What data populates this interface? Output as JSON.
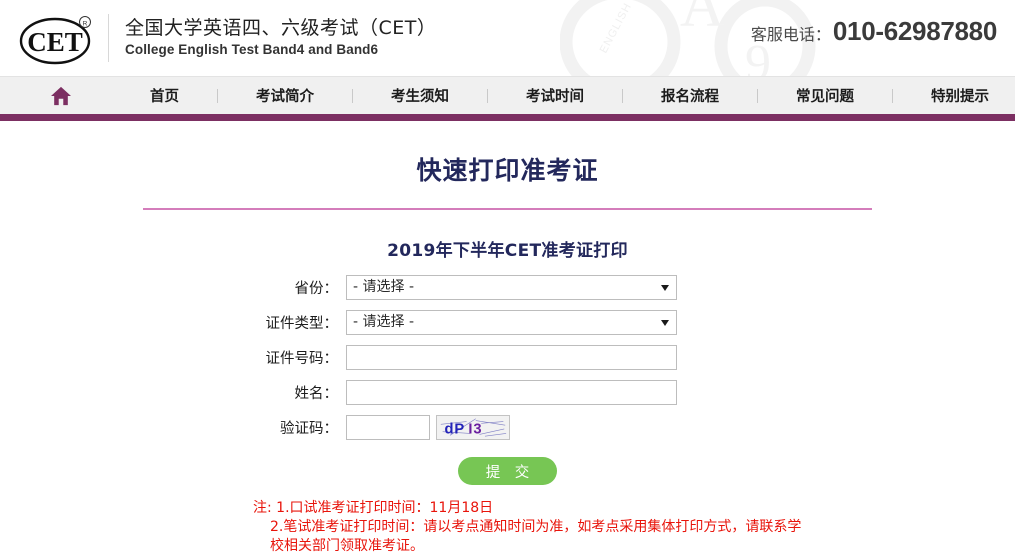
{
  "header": {
    "logo_text": "CET",
    "logo_registered_mark": "®",
    "brand_cn": "全国大学英语四、六级考试（CET）",
    "brand_en": "College English Test Band4 and Band6",
    "hotline_label": "客服电话：",
    "hotline_number": "010-62987880",
    "watermark_icon": "decorative-letter-watermark"
  },
  "nav": {
    "home_icon": "home-icon",
    "items": [
      {
        "label": "首页"
      },
      {
        "label": "考试简介"
      },
      {
        "label": "考生须知"
      },
      {
        "label": "考试时间"
      },
      {
        "label": "报名流程"
      },
      {
        "label": "常见问题"
      },
      {
        "label": "特别提示"
      }
    ],
    "bar_color": "#7c2f62",
    "background_color": "#f0f0f0"
  },
  "main": {
    "page_title": "快速打印准考证",
    "title_rule_color": "#d47dbb",
    "sub_title": "2019年下半年CET准考证打印",
    "title_color": "#23285c"
  },
  "form": {
    "province": {
      "label": "省份：",
      "value": "- 请选择 -",
      "options": [
        "- 请选择 -"
      ]
    },
    "id_type": {
      "label": "证件类型：",
      "value": "- 请选择 -",
      "options": [
        "- 请选择 -"
      ]
    },
    "id_number": {
      "label": "证件号码：",
      "value": "",
      "placeholder": ""
    },
    "name": {
      "label": "姓名：",
      "value": "",
      "placeholder": ""
    },
    "captcha": {
      "label": "验证码：",
      "value": "",
      "placeholder": "",
      "image_text": "dPI3"
    },
    "submit_label": "提 交",
    "submit_color": "#77c654"
  },
  "notes": {
    "color": "#e8140b",
    "line1": "注: 1.口试准考证打印时间：11月18日",
    "line2": "2.笔试准考证打印时间：请以考点通知时间为准，如考点采用集体打印方式，请联系学校相关部门领取准考证。"
  }
}
